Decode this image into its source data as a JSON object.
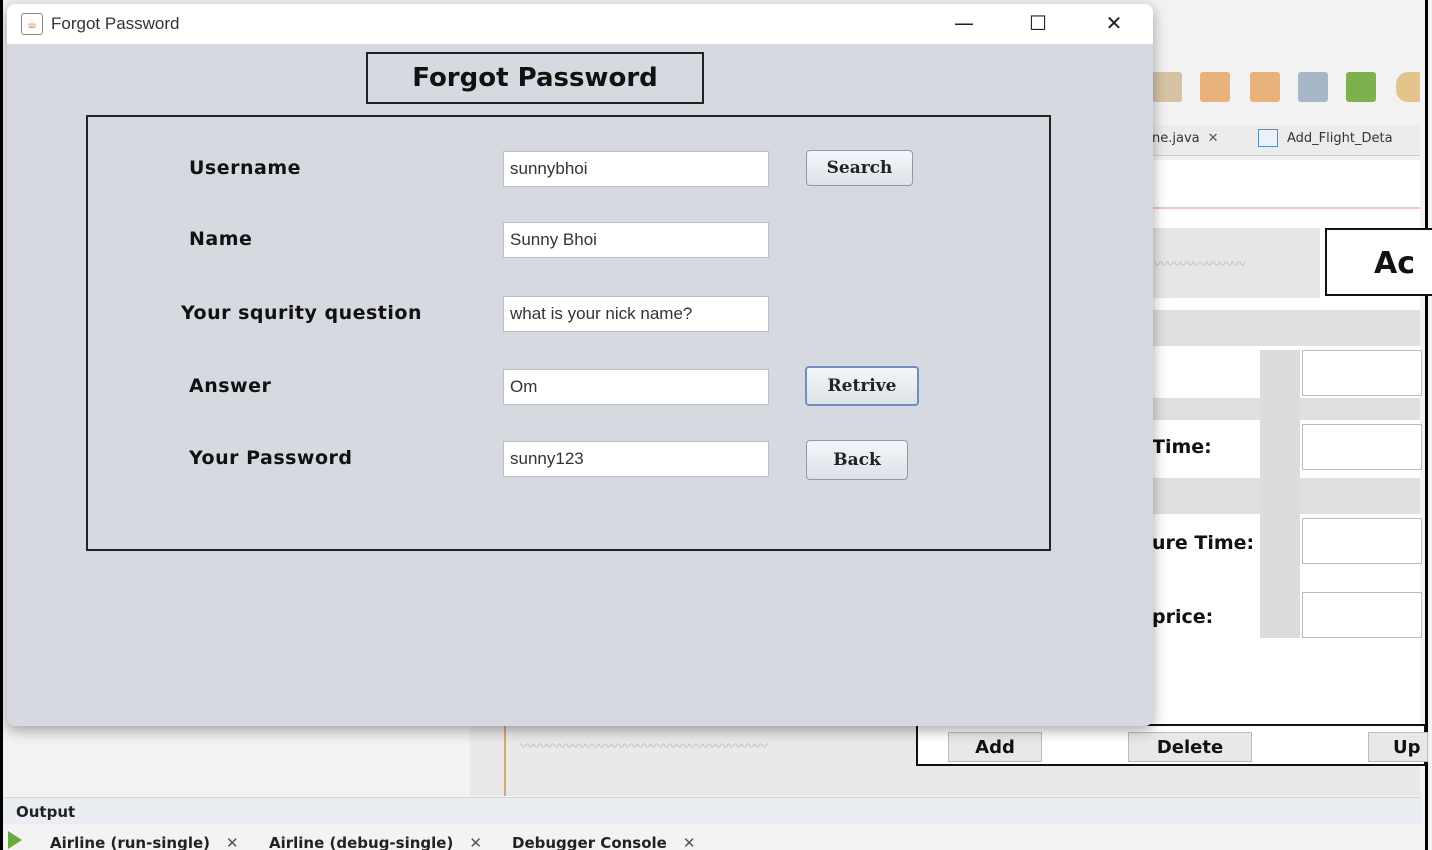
{
  "dialog": {
    "title": "Forgot Password",
    "window_controls": {
      "minimize": "—",
      "maximize": "☐",
      "close": "✕"
    },
    "heading": "Forgot Password",
    "fields": [
      {
        "label": "Username",
        "value": "sunnybhoi"
      },
      {
        "label": "Name",
        "value": "Sunny Bhoi"
      },
      {
        "label": "Your squrity question",
        "value": "what is your nick name?"
      },
      {
        "label": "Answer",
        "value": "Om"
      },
      {
        "label": "Your Password",
        "value": "sunny123"
      }
    ],
    "buttons": {
      "search": "Search",
      "retrive": "Retrive",
      "back": "Back"
    }
  },
  "ide": {
    "file_tabs": [
      "ne.java",
      "Add_Flight_Deta"
    ],
    "form_heading_fragment": "Ac",
    "labels": [
      "Time:",
      "ure Time:",
      "price:"
    ],
    "buttons": [
      "Add",
      "Delete",
      "Up"
    ],
    "output_label": "Output",
    "run_tabs": [
      "Airline (run-single)",
      "Airline (debug-single)",
      "Debugger Console"
    ],
    "toolbar_icons": [
      "redo-icon",
      "download-icon",
      "upload-icon",
      "debug-icon",
      "network-icon"
    ]
  }
}
